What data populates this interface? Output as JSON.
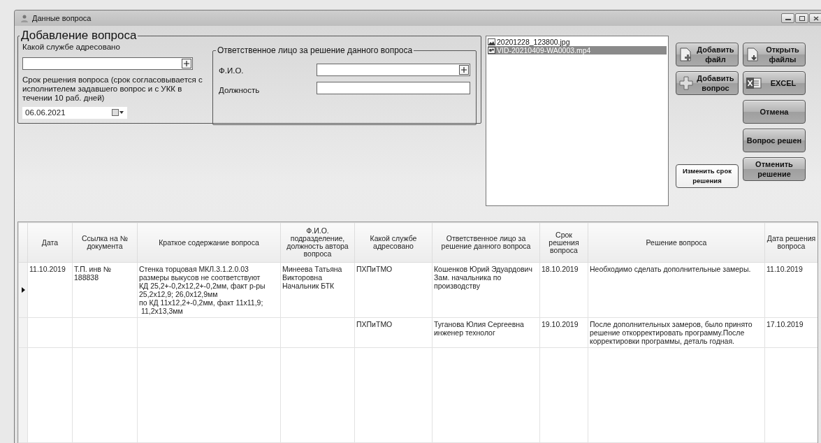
{
  "window": {
    "title": "Данные вопроса"
  },
  "form": {
    "title": "Добавление вопроса",
    "service_label": "Какой службе адресовано",
    "deadline_label": "Срок решения вопроса (срок согласовывается с исполнителем задавшего вопрос и с УКК в течении 10 раб. дней)",
    "deadline_value": "06.06.2021",
    "responsible": {
      "title": "Ответственное лицо за решение данного вопроса",
      "name_label": "Ф.И.О.",
      "position_label": "Должность"
    }
  },
  "files": [
    {
      "name": "20201228_123800.jpg",
      "kind": "image",
      "selected": false
    },
    {
      "name": "VID-20210409-WA0003.mp4",
      "kind": "video",
      "selected": true
    }
  ],
  "buttons": {
    "left": [
      {
        "label": "Добавить файл",
        "kind": "add-file"
      },
      {
        "label": "Добавить вопрос",
        "kind": "add"
      },
      {
        "label": "Изменить срок решения",
        "kind": "light"
      }
    ],
    "right": [
      {
        "label": "Открыть файлы",
        "kind": "open-file"
      },
      {
        "label": "EXCEL",
        "kind": "excel"
      },
      {
        "label": "Отмена",
        "kind": "plain"
      },
      {
        "label": "Вопрос решен",
        "kind": "plain"
      },
      {
        "label": "Отменить решение",
        "kind": "plain"
      }
    ]
  },
  "table": {
    "columns": [
      "Дата",
      "Ссылка на № документа",
      "Краткое содержание вопроса",
      "Ф.И.О. подразделение, должность автора вопроса",
      "Какой службе адресовано",
      "Ответственное лицо за решение данного вопроса",
      "Срок решения вопроса",
      "Решение вопроса",
      "Дата решения вопроса"
    ],
    "rows": [
      {
        "selected": true,
        "cells": [
          "11.10.2019",
          "Т.П. инв №\n188838",
          "Стенка торцовая МКЛ.3.1.2.0.03\nразмеры выкусов не соответствуют\nКД 25,2+-0,2х12,2+-0,2мм, факт р-ры\n25,2х12,9; 26,0х12,9мм\nпо КД 11х12,2+-0,2мм, факт 11х11,9;\n 11,2х13,3мм",
          "Минеева Татьяна\nВикторовна\nНачальник БТК",
          "ПХПиТМО",
          "Кошенков Юрий Эдуардович\nЗам. начальника по\nпроизводству",
          "18.10.2019",
          "Необходимо сделать дополнительные замеры.",
          "11.10.2019"
        ]
      },
      {
        "selected": false,
        "cells": [
          null,
          null,
          null,
          null,
          "ПХПиТМО",
          "Туганова Юлия Сергеевна\nинженер технолог",
          "19.10.2019",
          "После дополнительных замеров, было принято\nрешение откорректировать программу.После\nкорректировки программы, деталь годная.",
          "17.10.2019"
        ]
      }
    ]
  }
}
